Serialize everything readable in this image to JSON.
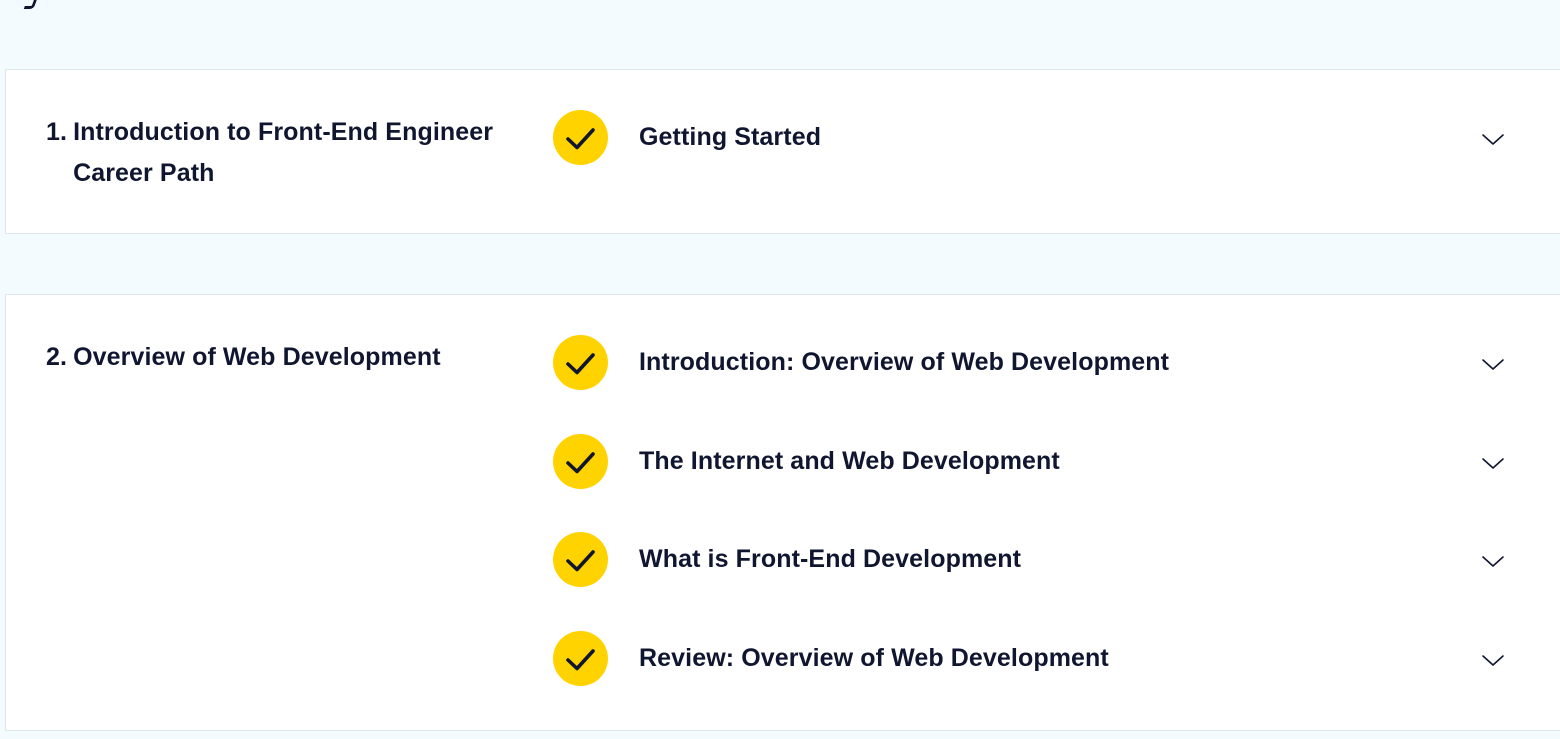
{
  "modules": [
    {
      "number": "1.",
      "title": "Introduction to Front-End Engineer Career Path",
      "lessons": [
        {
          "title": "Getting Started",
          "completed": true
        }
      ]
    },
    {
      "number": "2.",
      "title": "Overview of Web Development",
      "lessons": [
        {
          "title": "Introduction: Overview of Web Development",
          "completed": true
        },
        {
          "title": "The Internet and Web Development",
          "completed": true
        },
        {
          "title": "What is Front-End Development",
          "completed": true
        },
        {
          "title": "Review: Overview of Web Development",
          "completed": true
        }
      ]
    }
  ],
  "icons": {
    "completed": "checkmark-icon",
    "expand": "chevron-down-icon"
  },
  "colors": {
    "page_background": "#f4fbfe",
    "card_background": "#ffffff",
    "text": "#10162f",
    "check_badge": "#ffd300"
  }
}
